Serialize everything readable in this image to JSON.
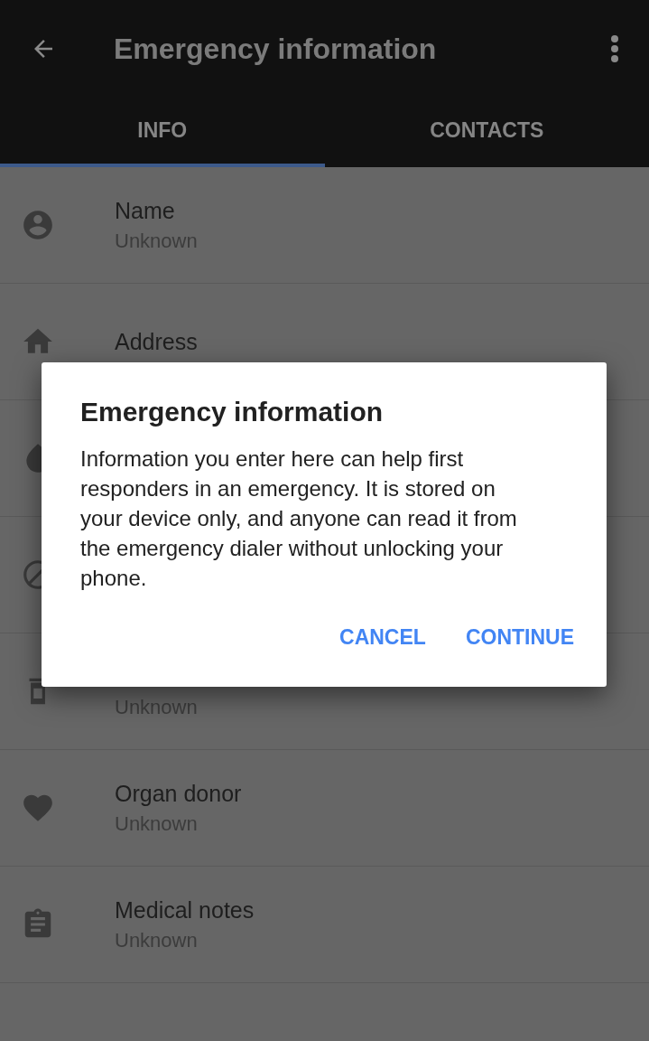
{
  "toolbar": {
    "title": "Emergency information"
  },
  "tabs": [
    {
      "label": "INFO",
      "selected": true
    },
    {
      "label": "CONTACTS",
      "selected": false
    }
  ],
  "rows": [
    {
      "label": "Name",
      "value": "Unknown"
    },
    {
      "label": "Address"
    },
    {},
    {},
    {
      "value": "Unknown"
    },
    {
      "label": "Organ donor",
      "value": "Unknown"
    },
    {
      "label": "Medical notes",
      "value": "Unknown"
    }
  ],
  "dialog": {
    "title": "Emergency information",
    "message": "Information you enter here can help first responders in an emergency. It is stored on your device only, and anyone can read it from the emergency dialer without unlocking your phone.",
    "buttons": [
      "CANCEL",
      "CONTINUE"
    ]
  }
}
